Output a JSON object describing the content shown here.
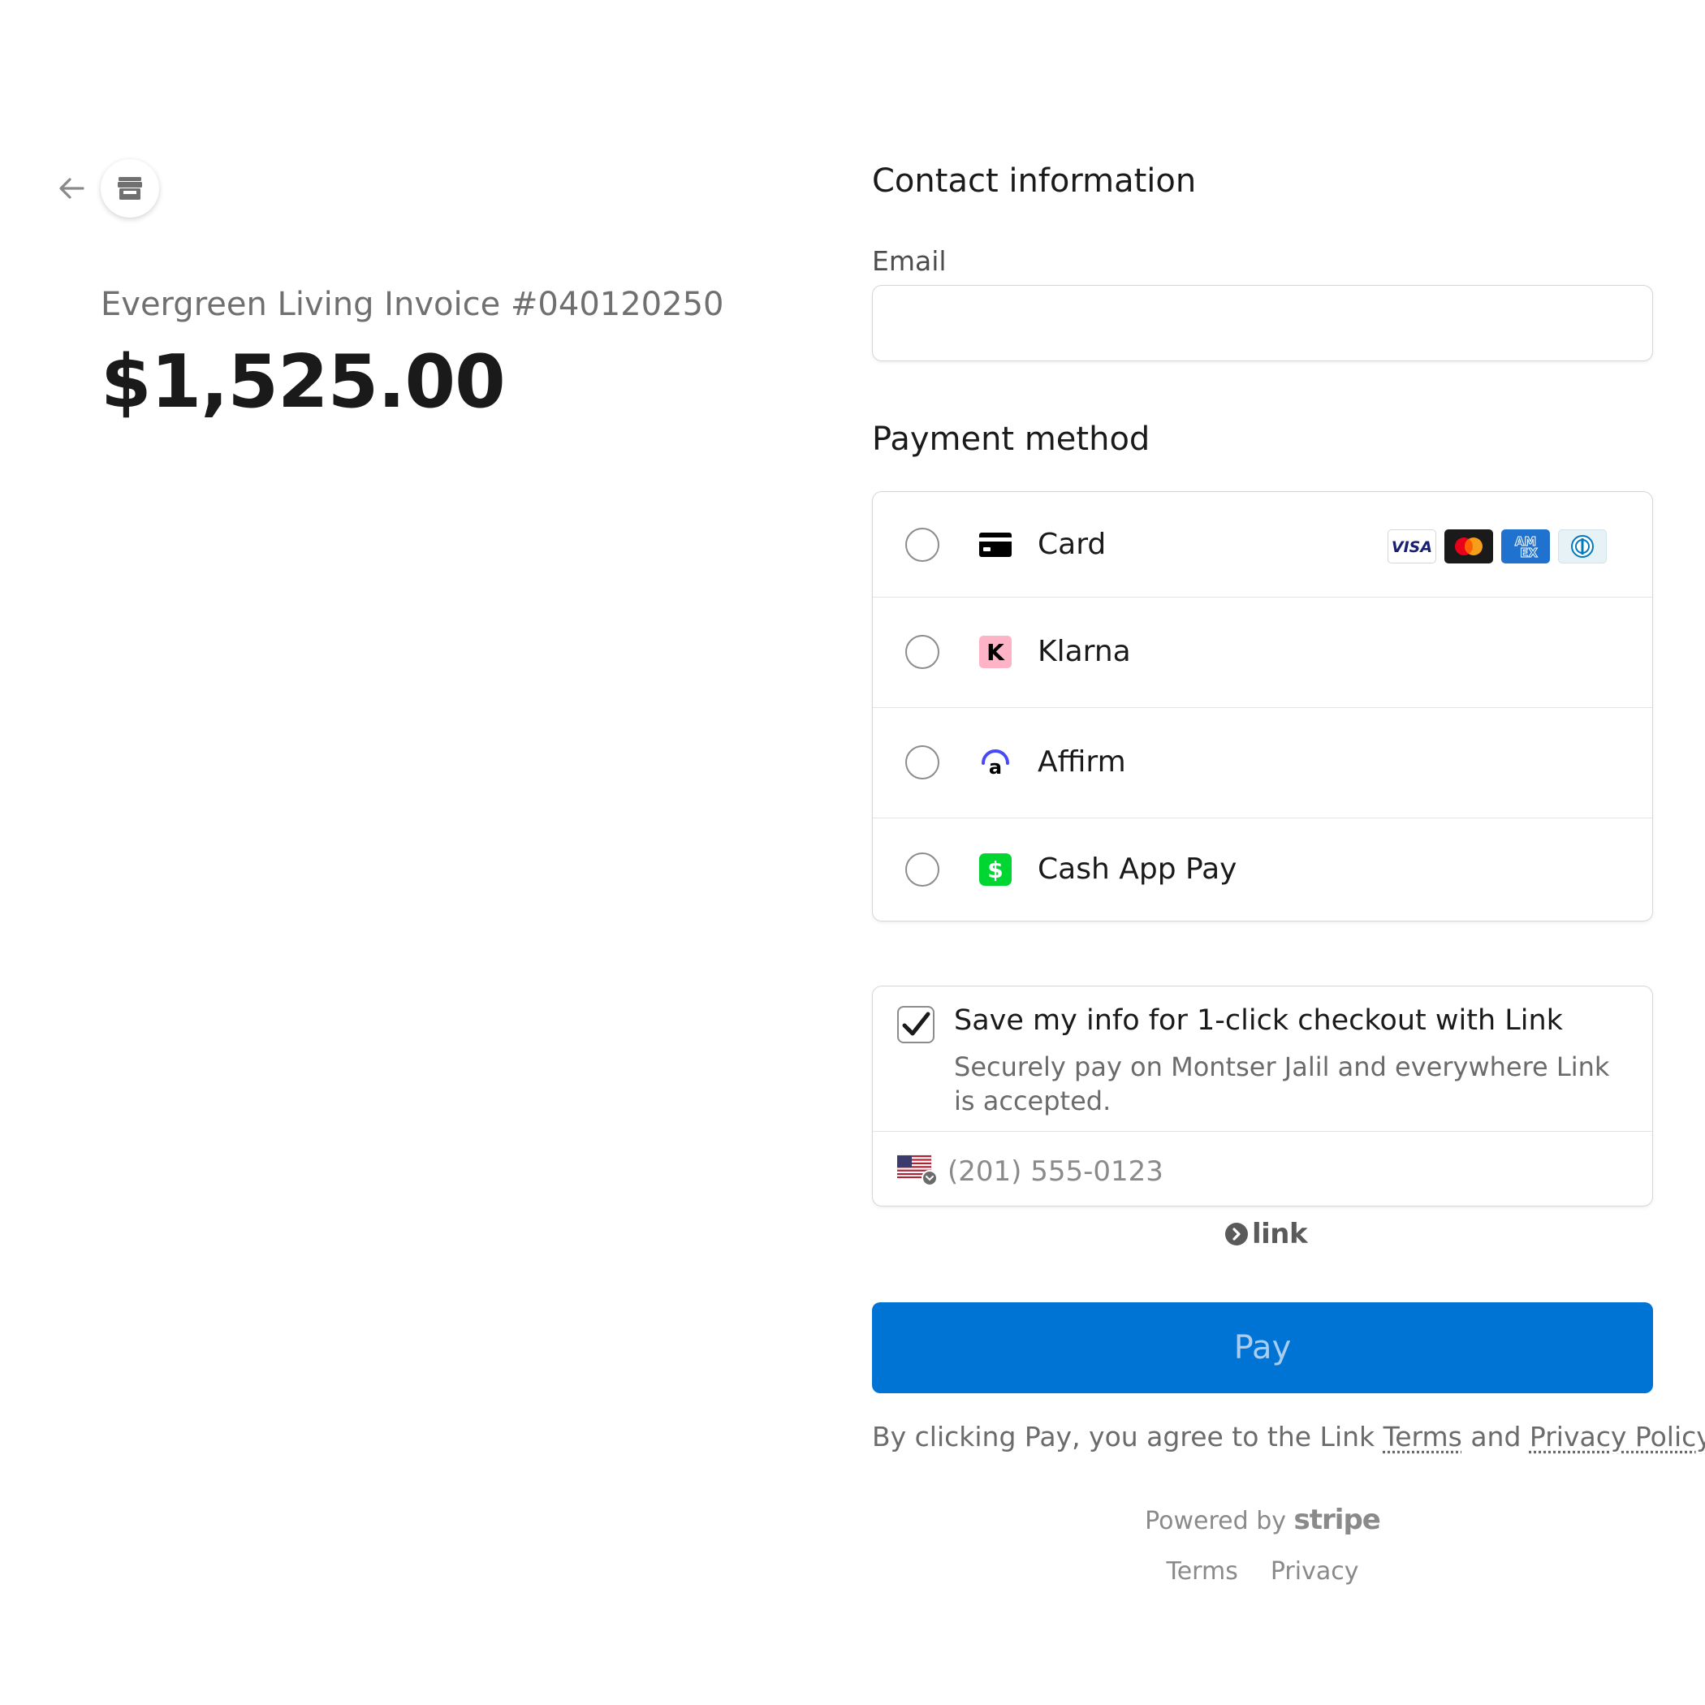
{
  "header": {
    "back_icon": "arrow-left-icon",
    "shop_icon": "storefront-icon"
  },
  "summary": {
    "invoice_title": "Evergreen Living Invoice #040120250",
    "amount": "$1,525.00"
  },
  "contact": {
    "heading": "Contact information",
    "email_label": "Email",
    "email_value": ""
  },
  "payment": {
    "heading": "Payment method",
    "methods": [
      {
        "label": "Card",
        "icon": "credit-card-icon",
        "selected": false
      },
      {
        "label": "Klarna",
        "icon": "klarna-icon",
        "selected": false
      },
      {
        "label": "Affirm",
        "icon": "affirm-icon",
        "selected": false
      },
      {
        "label": "Cash App Pay",
        "icon": "cash-app-icon",
        "selected": false
      }
    ],
    "card_brands": [
      {
        "name": "VISA",
        "color": "#1a1f71"
      },
      {
        "name": "mastercard",
        "color": "#eb001b"
      },
      {
        "name": "AMEX",
        "color": "#1f72cd"
      },
      {
        "name": "diners",
        "color": "#0079be"
      }
    ]
  },
  "link": {
    "checked": true,
    "save_title": "Save my info for 1-click checkout with Link",
    "save_subtitle": "Securely pay on Montser Jalil and everywhere Link is accepted.",
    "phone_placeholder": "(201) 555-0123",
    "country_icon": "us-flag-icon",
    "logo_text": "link"
  },
  "pay": {
    "label": "Pay"
  },
  "terms": {
    "prefix": "By clicking Pay, you agree to the Link ",
    "terms_link": "Terms",
    "middle": " and ",
    "privacy_link": "Privacy Policy",
    "suffix": "."
  },
  "footer": {
    "powered_prefix": "Powered by ",
    "powered_brand": "stripe",
    "terms": "Terms",
    "privacy": "Privacy"
  },
  "colors": {
    "pay_button": "#0074d4",
    "klarna": "#ffb3c7",
    "affirm": "#4a4af4",
    "cash_app": "#00d632"
  }
}
